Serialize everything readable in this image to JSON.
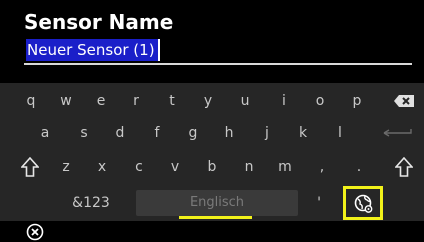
{
  "header": {
    "title": "Sensor Name",
    "field_value": "Neuer Sensor (1)"
  },
  "keyboard": {
    "row1": [
      "q",
      "w",
      "e",
      "r",
      "t",
      "y",
      "u",
      "i",
      "o",
      "p"
    ],
    "row2": [
      "a",
      "s",
      "d",
      "f",
      "g",
      "h",
      "j",
      "k",
      "l"
    ],
    "row3": [
      "z",
      "x",
      "c",
      "v",
      "b",
      "n",
      "m",
      ",",
      "."
    ],
    "symbols_label": "&123",
    "space_label": "Englisch",
    "apostrophe": "'",
    "icons": {
      "backspace": "backspace-icon",
      "enter": "enter-icon",
      "shift_left": "shift-icon",
      "shift_right": "shift-icon",
      "language": "globe-settings-icon",
      "close": "close-circle-icon"
    }
  },
  "colors": {
    "background": "#000000",
    "keyboard_background": "#262626",
    "selection": "#1a1fc9",
    "highlight": "#f2f21a",
    "key_text": "#c8c8c8"
  }
}
